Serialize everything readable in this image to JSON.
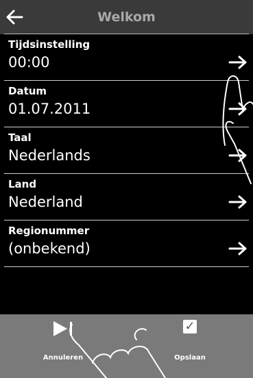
{
  "header": {
    "title": "Welkom",
    "back_icon": "arrow-left-icon"
  },
  "settings": [
    {
      "label": "Tijdsinstelling",
      "value": "00:00"
    },
    {
      "label": "Datum",
      "value": "01.07.2011"
    },
    {
      "label": "Taal",
      "value": "Nederlands"
    },
    {
      "label": "Land",
      "value": "Nederland"
    },
    {
      "label": "Regionummer",
      "value": "(onbekend)"
    }
  ],
  "footer": {
    "cancel_label": "Annuleren",
    "cancel_icon": "play-pause-icon",
    "save_label": "Opslaan",
    "save_icon": "checkbox-checked-icon"
  },
  "colors": {
    "header_bg": "#3a3a3a",
    "footer_bg": "#7a7a7a",
    "background": "#000000",
    "title": "#a8a8a8"
  }
}
